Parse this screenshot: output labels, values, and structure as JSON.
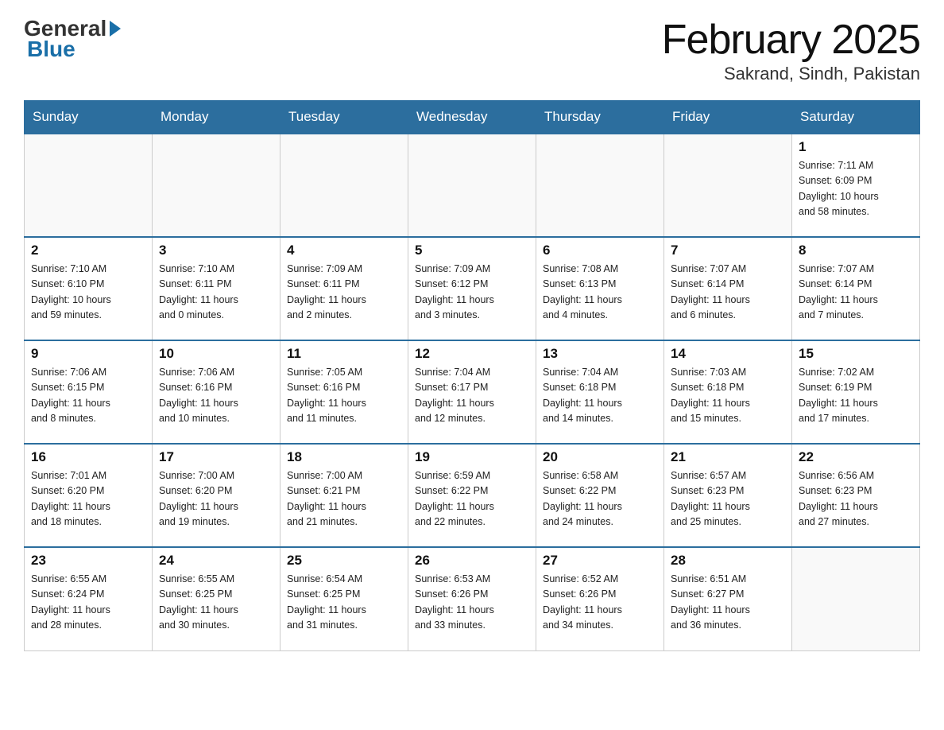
{
  "header": {
    "logo_general": "General",
    "logo_blue": "Blue",
    "month_title": "February 2025",
    "location": "Sakrand, Sindh, Pakistan"
  },
  "days_of_week": [
    "Sunday",
    "Monday",
    "Tuesday",
    "Wednesday",
    "Thursday",
    "Friday",
    "Saturday"
  ],
  "weeks": [
    [
      {
        "day": "",
        "info": ""
      },
      {
        "day": "",
        "info": ""
      },
      {
        "day": "",
        "info": ""
      },
      {
        "day": "",
        "info": ""
      },
      {
        "day": "",
        "info": ""
      },
      {
        "day": "",
        "info": ""
      },
      {
        "day": "1",
        "info": "Sunrise: 7:11 AM\nSunset: 6:09 PM\nDaylight: 10 hours\nand 58 minutes."
      }
    ],
    [
      {
        "day": "2",
        "info": "Sunrise: 7:10 AM\nSunset: 6:10 PM\nDaylight: 10 hours\nand 59 minutes."
      },
      {
        "day": "3",
        "info": "Sunrise: 7:10 AM\nSunset: 6:11 PM\nDaylight: 11 hours\nand 0 minutes."
      },
      {
        "day": "4",
        "info": "Sunrise: 7:09 AM\nSunset: 6:11 PM\nDaylight: 11 hours\nand 2 minutes."
      },
      {
        "day": "5",
        "info": "Sunrise: 7:09 AM\nSunset: 6:12 PM\nDaylight: 11 hours\nand 3 minutes."
      },
      {
        "day": "6",
        "info": "Sunrise: 7:08 AM\nSunset: 6:13 PM\nDaylight: 11 hours\nand 4 minutes."
      },
      {
        "day": "7",
        "info": "Sunrise: 7:07 AM\nSunset: 6:14 PM\nDaylight: 11 hours\nand 6 minutes."
      },
      {
        "day": "8",
        "info": "Sunrise: 7:07 AM\nSunset: 6:14 PM\nDaylight: 11 hours\nand 7 minutes."
      }
    ],
    [
      {
        "day": "9",
        "info": "Sunrise: 7:06 AM\nSunset: 6:15 PM\nDaylight: 11 hours\nand 8 minutes."
      },
      {
        "day": "10",
        "info": "Sunrise: 7:06 AM\nSunset: 6:16 PM\nDaylight: 11 hours\nand 10 minutes."
      },
      {
        "day": "11",
        "info": "Sunrise: 7:05 AM\nSunset: 6:16 PM\nDaylight: 11 hours\nand 11 minutes."
      },
      {
        "day": "12",
        "info": "Sunrise: 7:04 AM\nSunset: 6:17 PM\nDaylight: 11 hours\nand 12 minutes."
      },
      {
        "day": "13",
        "info": "Sunrise: 7:04 AM\nSunset: 6:18 PM\nDaylight: 11 hours\nand 14 minutes."
      },
      {
        "day": "14",
        "info": "Sunrise: 7:03 AM\nSunset: 6:18 PM\nDaylight: 11 hours\nand 15 minutes."
      },
      {
        "day": "15",
        "info": "Sunrise: 7:02 AM\nSunset: 6:19 PM\nDaylight: 11 hours\nand 17 minutes."
      }
    ],
    [
      {
        "day": "16",
        "info": "Sunrise: 7:01 AM\nSunset: 6:20 PM\nDaylight: 11 hours\nand 18 minutes."
      },
      {
        "day": "17",
        "info": "Sunrise: 7:00 AM\nSunset: 6:20 PM\nDaylight: 11 hours\nand 19 minutes."
      },
      {
        "day": "18",
        "info": "Sunrise: 7:00 AM\nSunset: 6:21 PM\nDaylight: 11 hours\nand 21 minutes."
      },
      {
        "day": "19",
        "info": "Sunrise: 6:59 AM\nSunset: 6:22 PM\nDaylight: 11 hours\nand 22 minutes."
      },
      {
        "day": "20",
        "info": "Sunrise: 6:58 AM\nSunset: 6:22 PM\nDaylight: 11 hours\nand 24 minutes."
      },
      {
        "day": "21",
        "info": "Sunrise: 6:57 AM\nSunset: 6:23 PM\nDaylight: 11 hours\nand 25 minutes."
      },
      {
        "day": "22",
        "info": "Sunrise: 6:56 AM\nSunset: 6:23 PM\nDaylight: 11 hours\nand 27 minutes."
      }
    ],
    [
      {
        "day": "23",
        "info": "Sunrise: 6:55 AM\nSunset: 6:24 PM\nDaylight: 11 hours\nand 28 minutes."
      },
      {
        "day": "24",
        "info": "Sunrise: 6:55 AM\nSunset: 6:25 PM\nDaylight: 11 hours\nand 30 minutes."
      },
      {
        "day": "25",
        "info": "Sunrise: 6:54 AM\nSunset: 6:25 PM\nDaylight: 11 hours\nand 31 minutes."
      },
      {
        "day": "26",
        "info": "Sunrise: 6:53 AM\nSunset: 6:26 PM\nDaylight: 11 hours\nand 33 minutes."
      },
      {
        "day": "27",
        "info": "Sunrise: 6:52 AM\nSunset: 6:26 PM\nDaylight: 11 hours\nand 34 minutes."
      },
      {
        "day": "28",
        "info": "Sunrise: 6:51 AM\nSunset: 6:27 PM\nDaylight: 11 hours\nand 36 minutes."
      },
      {
        "day": "",
        "info": ""
      }
    ]
  ]
}
